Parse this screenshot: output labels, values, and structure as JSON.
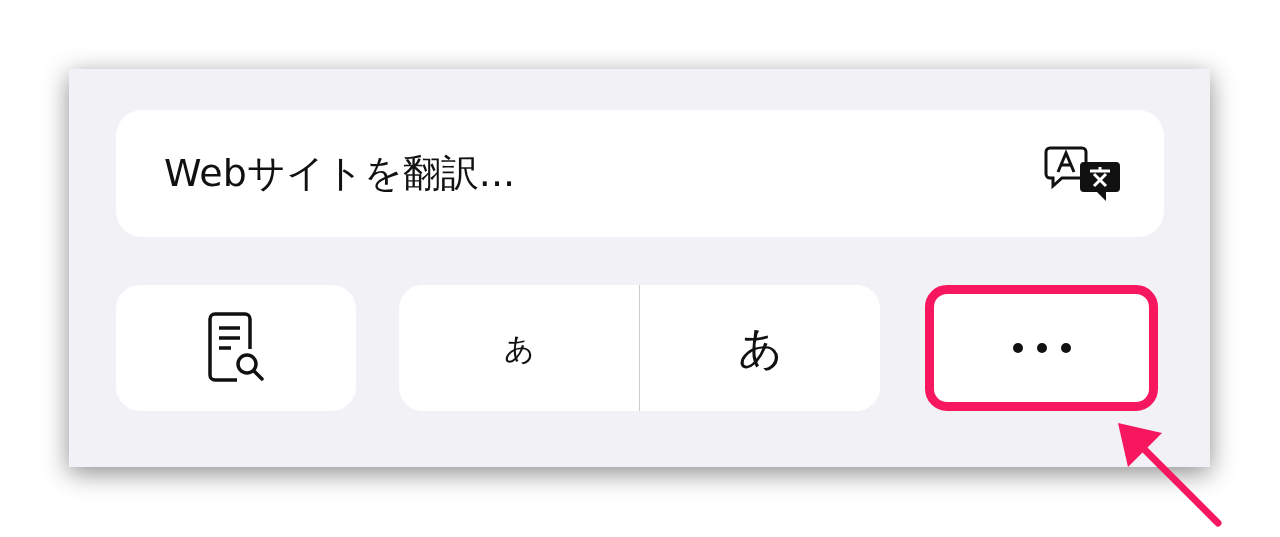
{
  "translate_button": {
    "label": "Webサイトを翻訳..."
  },
  "buttons": [
    {
      "kind": "reader",
      "highlighted": false
    },
    {
      "kind": "font_size",
      "smaller_label": "あ",
      "larger_label": "あ",
      "highlighted": false
    },
    {
      "kind": "more",
      "highlighted": true
    }
  ]
}
